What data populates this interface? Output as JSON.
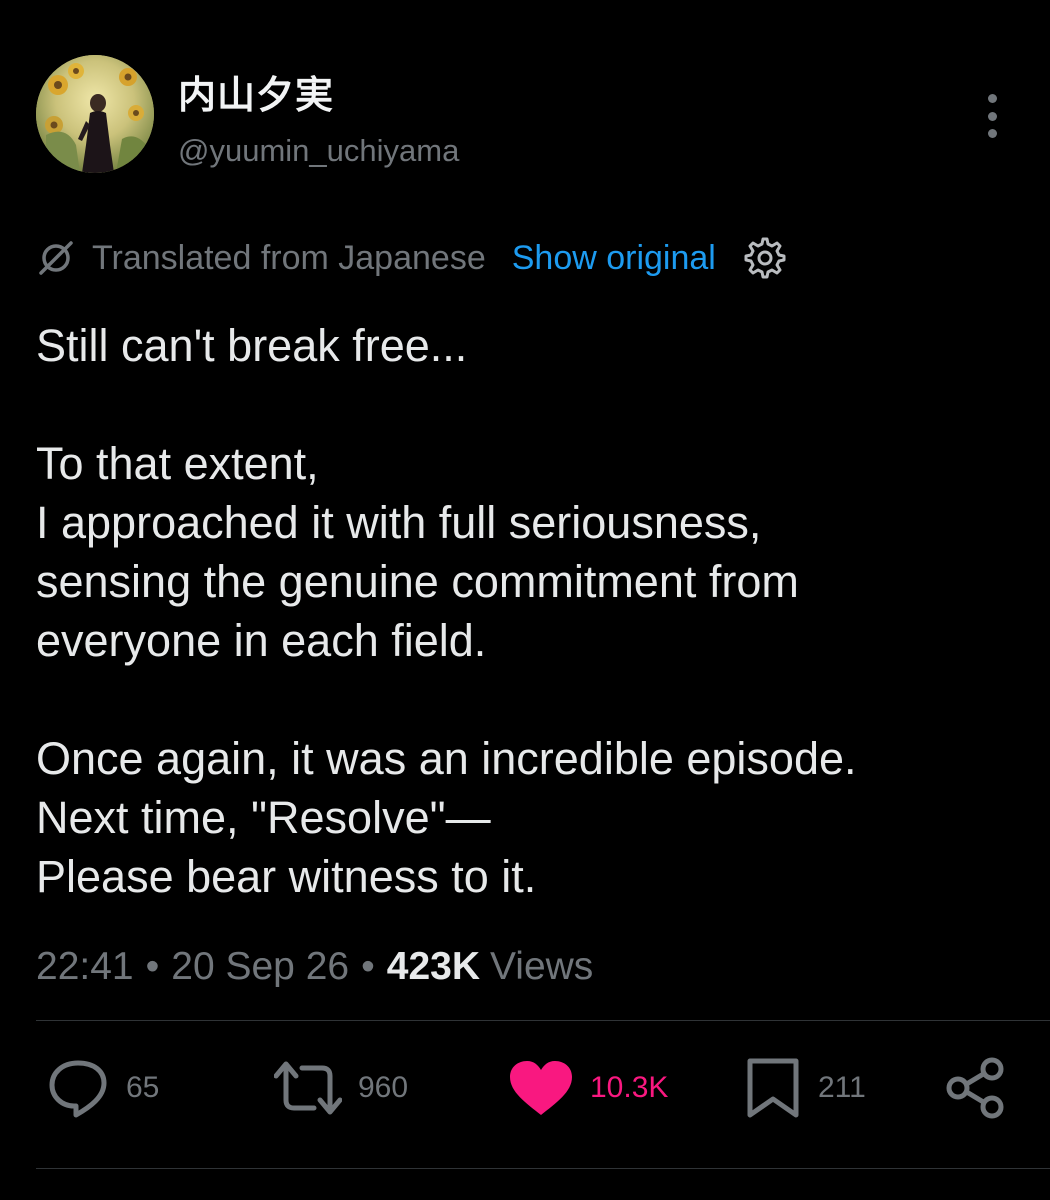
{
  "author": {
    "display_name": "内山夕実",
    "handle": "@yuumin_uchiyama"
  },
  "icons": {
    "more": "more-vertical-icon",
    "translate": "translate-icon",
    "settings": "gear-icon",
    "reply": "reply-icon",
    "retweet": "retweet-icon",
    "like": "heart-icon",
    "bookmark": "bookmark-icon",
    "share": "share-icon"
  },
  "translation": {
    "label": "Translated from Japanese",
    "show_original": "Show original"
  },
  "tweet": {
    "lines": [
      "Still can't break free...",
      "To that extent,",
      "I approached it with full seriousness,",
      "sensing the genuine commitment from",
      "everyone in each field.",
      "Once again, it was an incredible episode.",
      "Next time, \"Resolve\"—",
      "Please bear witness to it."
    ]
  },
  "meta": {
    "time": "22:41",
    "date": "20 Sep 26",
    "separator": "•",
    "views_count": "423K",
    "views_label": "Views"
  },
  "actions": {
    "reply_count": "65",
    "retweet_count": "960",
    "like_count": "10.3K",
    "bookmark_count": "211"
  },
  "colors": {
    "background": "#000000",
    "text": "#e7e9ea",
    "muted": "#71767b",
    "link": "#1d9bf0",
    "like": "#f91880",
    "divider": "#2f3336"
  }
}
